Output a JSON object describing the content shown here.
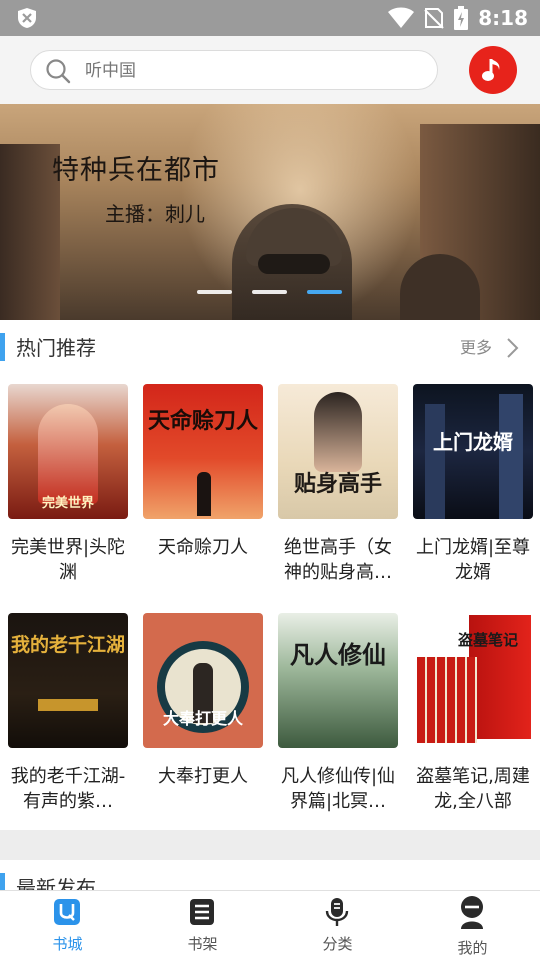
{
  "status_bar": {
    "time": "8:18"
  },
  "search": {
    "placeholder": "听中国"
  },
  "banner": {
    "title": "特种兵在都市",
    "narrator": "主播：刺儿",
    "active_dot": 3,
    "dot_count": 3
  },
  "hot_section": {
    "title": "热门推荐",
    "more_label": "更多"
  },
  "books": [
    {
      "title": "完美世界|头陀渊",
      "cover_text": "完美世界"
    },
    {
      "title": "天命赊刀人",
      "cover_text": "天命赊刀人"
    },
    {
      "title": "绝世高手（女神的贴身高…",
      "cover_text": "贴身高手"
    },
    {
      "title": "上门龙婿|至尊龙婿",
      "cover_text": "上门龙婿"
    },
    {
      "title": "我的老千江湖-有声的紫…",
      "cover_text": "我的老千江湖"
    },
    {
      "title": "大奉打更人",
      "cover_text": "大奉打更人"
    },
    {
      "title": "凡人修仙传|仙界篇|北冥…",
      "cover_text": "凡人修仙"
    },
    {
      "title": "盗墓笔记,周建龙,全八部",
      "cover_text": "盗墓笔记"
    }
  ],
  "latest_section": {
    "title": "最新发布"
  },
  "bottom_nav": [
    {
      "label": "书城",
      "icon": "store-icon",
      "active": true
    },
    {
      "label": "书架",
      "icon": "bookshelf-icon",
      "active": false
    },
    {
      "label": "分类",
      "icon": "microphone-icon",
      "active": false
    },
    {
      "label": "我的",
      "icon": "profile-icon",
      "active": false
    }
  ],
  "colors": {
    "accent": "#3fa2ee",
    "music_button": "#e7231b",
    "status_bar": "#9b9b9b"
  }
}
